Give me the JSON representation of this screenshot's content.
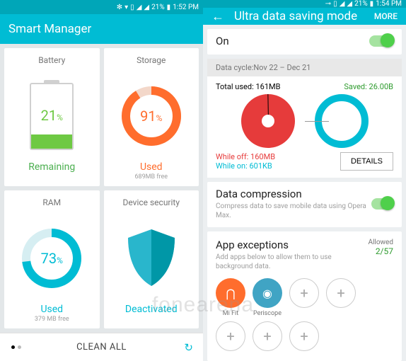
{
  "colors": {
    "accent": "#00bcd4",
    "green": "#4caf50",
    "orange": "#ff6d2d",
    "red": "#e63b3b"
  },
  "left": {
    "status": {
      "level": "21%",
      "time": "1:52 PM"
    },
    "title": "Smart Manager",
    "battery": {
      "title": "Battery",
      "pct": "21",
      "unit": "%",
      "footer": "Remaining"
    },
    "storage": {
      "title": "Storage",
      "pct": "91",
      "unit": "%",
      "footer": "Used",
      "sub": "689MB free"
    },
    "ram": {
      "title": "RAM",
      "pct": "73",
      "unit": "%",
      "footer": "Used",
      "sub": "379 MB free"
    },
    "security": {
      "title": "Device security",
      "footer": "Deactivated"
    },
    "clean": "CLEAN ALL"
  },
  "right": {
    "status": {
      "level": "21%",
      "time": "1:54 PM"
    },
    "title": "Ultra data saving mode",
    "more": "MORE",
    "on": "On",
    "cycle": "Data cycle:Nov 22 – Dec 21",
    "totalUsed": "Total used: 161MB",
    "saved": "Saved: 26.00B",
    "whileOff": "While off: 160MB",
    "whileOn": "While on: 601KB",
    "details": "DETAILS",
    "compression": {
      "title": "Data compression",
      "sub": "Compress data to save mobile data using Opera Max."
    },
    "exceptions": {
      "title": "App exceptions",
      "sub": "Add apps below to allow them to use background data.",
      "allowedLabel": "Allowed",
      "allowedCount": "2/57"
    },
    "apps": {
      "mifit": "Mi Fit",
      "periscope": "Periscope"
    }
  },
  "watermark": "fonearena",
  "chart_data": [
    {
      "type": "donut",
      "name": "storage",
      "value": 91,
      "max": 100,
      "color": "#ff6d2d"
    },
    {
      "type": "donut",
      "name": "ram",
      "value": 73,
      "max": 100,
      "color": "#00bcd4"
    },
    {
      "type": "gauge",
      "name": "battery",
      "value": 21,
      "max": 100,
      "color": "#6ec943"
    },
    {
      "type": "pie",
      "name": "data-usage",
      "series": [
        {
          "name": "While off",
          "value": 160,
          "unit": "MB",
          "color": "#e63b3b"
        },
        {
          "name": "While on",
          "value": 0.601,
          "unit": "MB",
          "color": "#00bcd4"
        }
      ],
      "total": "161MB",
      "saved": "26.00B"
    }
  ]
}
